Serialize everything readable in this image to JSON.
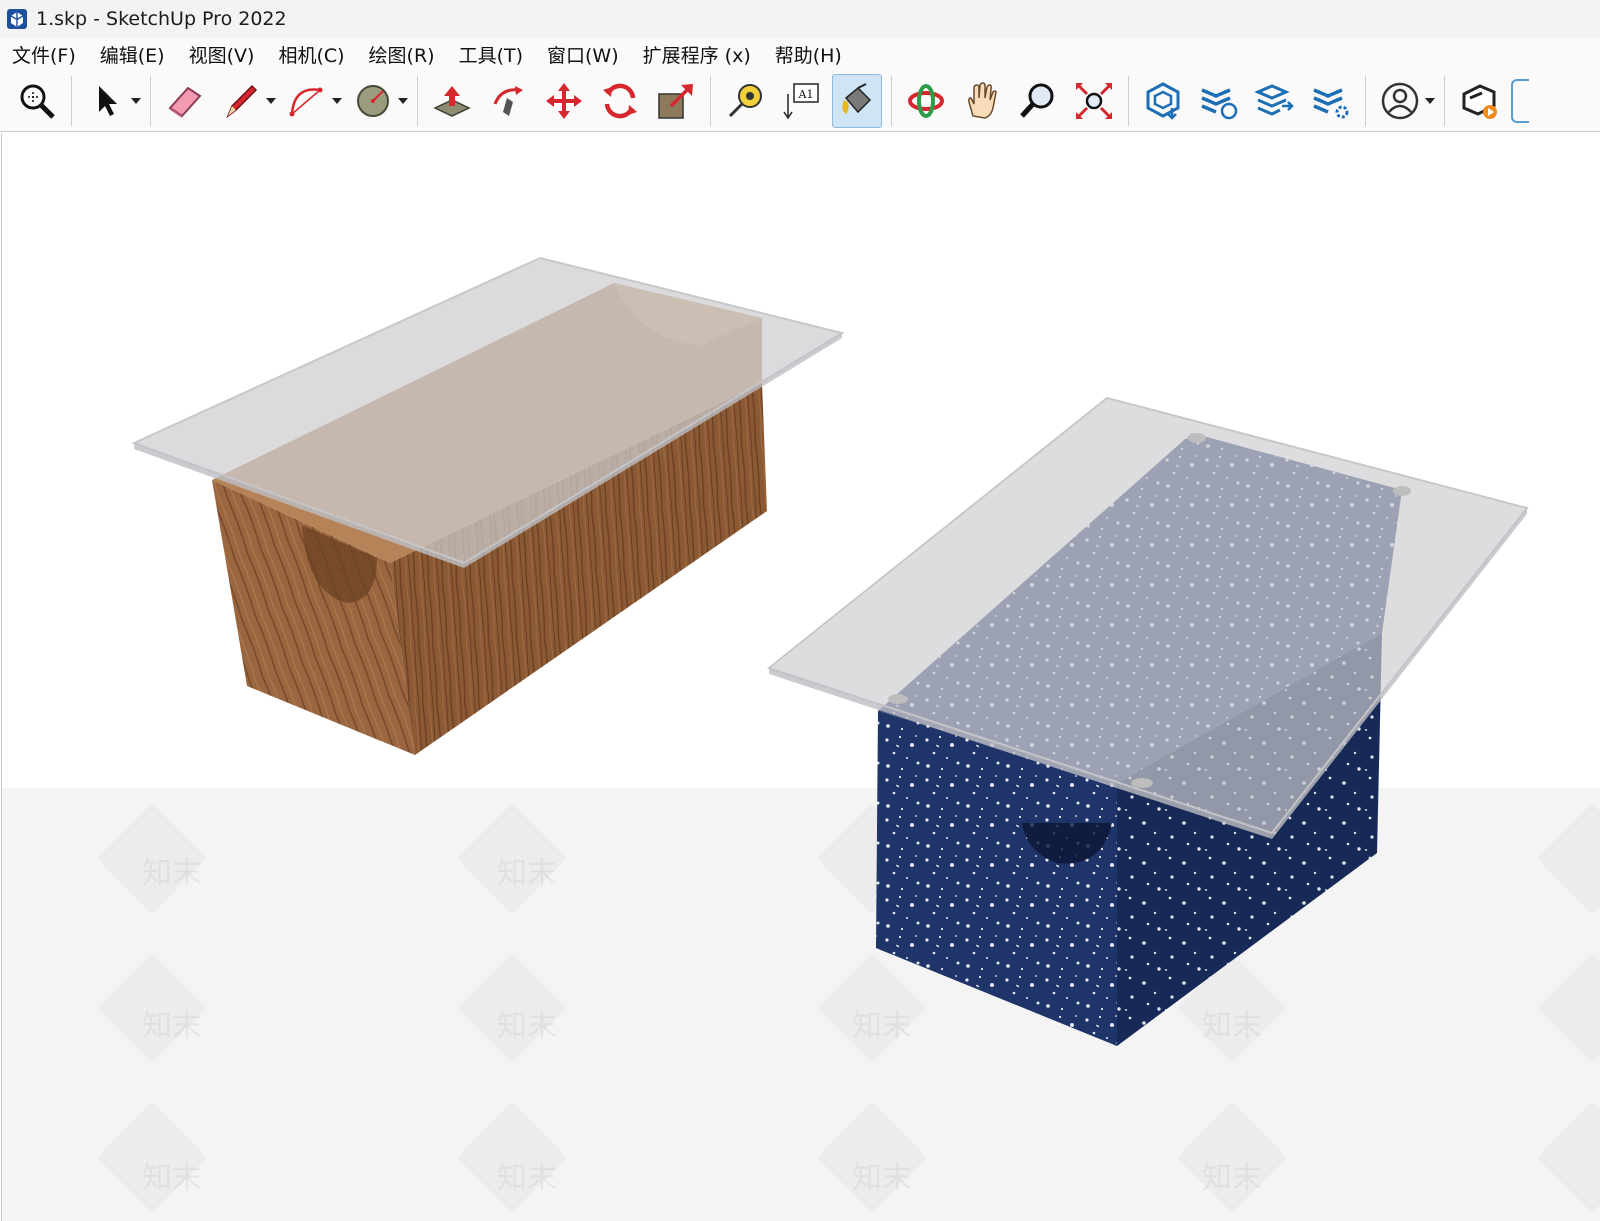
{
  "window": {
    "title": "1.skp - SketchUp Pro 2022",
    "app_icon": "sketchup-logo-icon"
  },
  "menu": [
    {
      "label": "文件(F)"
    },
    {
      "label": "编辑(E)"
    },
    {
      "label": "视图(V)"
    },
    {
      "label": "相机(C)"
    },
    {
      "label": "绘图(R)"
    },
    {
      "label": "工具(T)"
    },
    {
      "label": "窗口(W)"
    },
    {
      "label": "扩展程序 (x)"
    },
    {
      "label": "帮助(H)"
    }
  ],
  "toolbar": {
    "tools": [
      {
        "icon": "zoom-window-icon"
      },
      {
        "icon": "select-arrow-icon",
        "dropdown": true
      },
      {
        "icon": "eraser-icon"
      },
      {
        "icon": "pencil-line-icon",
        "dropdown": true
      },
      {
        "icon": "arc-icon",
        "dropdown": true
      },
      {
        "icon": "circle-icon",
        "dropdown": true
      },
      {
        "icon": "push-pull-icon"
      },
      {
        "icon": "follow-me-icon"
      },
      {
        "icon": "move-icon"
      },
      {
        "icon": "rotate-icon"
      },
      {
        "icon": "scale-icon"
      },
      {
        "icon": "tape-measure-icon"
      },
      {
        "icon": "text-label-icon",
        "text": "A1"
      },
      {
        "icon": "paint-bucket-icon",
        "active": true
      },
      {
        "icon": "orbit-icon"
      },
      {
        "icon": "pan-hand-icon"
      },
      {
        "icon": "zoom-magnifier-icon"
      },
      {
        "icon": "zoom-extents-icon"
      },
      {
        "icon": "3d-warehouse-icon"
      },
      {
        "icon": "extension-warehouse-icon"
      },
      {
        "icon": "layout-send-icon"
      },
      {
        "icon": "extension-manager-icon"
      },
      {
        "icon": "account-user-icon",
        "dropdown": true
      },
      {
        "icon": "trimble-connect-icon"
      }
    ]
  },
  "scene": {
    "objects": [
      {
        "name": "wood-table",
        "material": "wood",
        "color": "#8a5a34"
      },
      {
        "name": "terrazzo-table",
        "material": "terrazzo",
        "color": "#1f3468"
      }
    ],
    "watermark_text": "知末"
  }
}
